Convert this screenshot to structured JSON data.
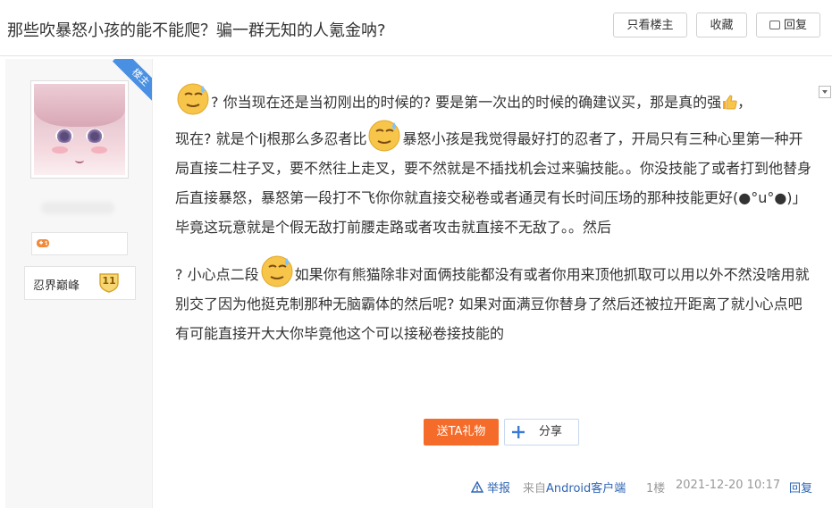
{
  "thread": {
    "title": "那些吹暴怒小孩的能不能爬？骗一群无知的人氪金呐?",
    "only_op_label": "只看楼主",
    "favorite_label": "收藏",
    "reply_label": "回复"
  },
  "author": {
    "op_badge": "楼主",
    "level_name": "忍界巅峰",
    "level_num": "11"
  },
  "post": {
    "p1_a": "? 你当现在还是当初刚出的时候的? 要是第一次出的时候的确建议买，那是真的强",
    "p1_b": "，",
    "p1_c": "现在? 就是个lj根那么多忍者比",
    "p1_d": "暴怒小孩是我觉得最好打的忍者了，开局只有三种心里第一种开局直接二柱子叉，要不然往上走叉，要不然就是不插找机会过来骗技能。。你没技能了或者打到他替身后直接暴怒，暴怒第一段打不飞你你就直接交秘卷或者通灵有长时间压场的那种技能更好(●°u°●)」毕竟这玩意就是个假无敌打前腰走路或者攻击就直接不无敌了。。然后",
    "p2_a": "? 小心点二段",
    "p2_b": "如果你有熊猫除非对面俩技能都没有或者你用来顶他抓取可以用以外不然没啥用就别交了因为他挺克制那种无脑霸体的然后呢? 如果对面满豆你替身了然后还被拉开距离了就小心点吧有可能直接开大大你毕竟他这个可以接秘卷接技能的"
  },
  "actions": {
    "gift_label": "送TA礼物",
    "share_label": "分享"
  },
  "footer": {
    "report": "举报",
    "source_prefix": "来自",
    "source_app": "Android客户端",
    "floor": "1楼",
    "time": "2021-12-20 10:17",
    "reply": "回复"
  },
  "colors": {
    "link": "#2d64b3",
    "gift_button": "#f56b2a",
    "op_ribbon": "#4a90e2"
  }
}
